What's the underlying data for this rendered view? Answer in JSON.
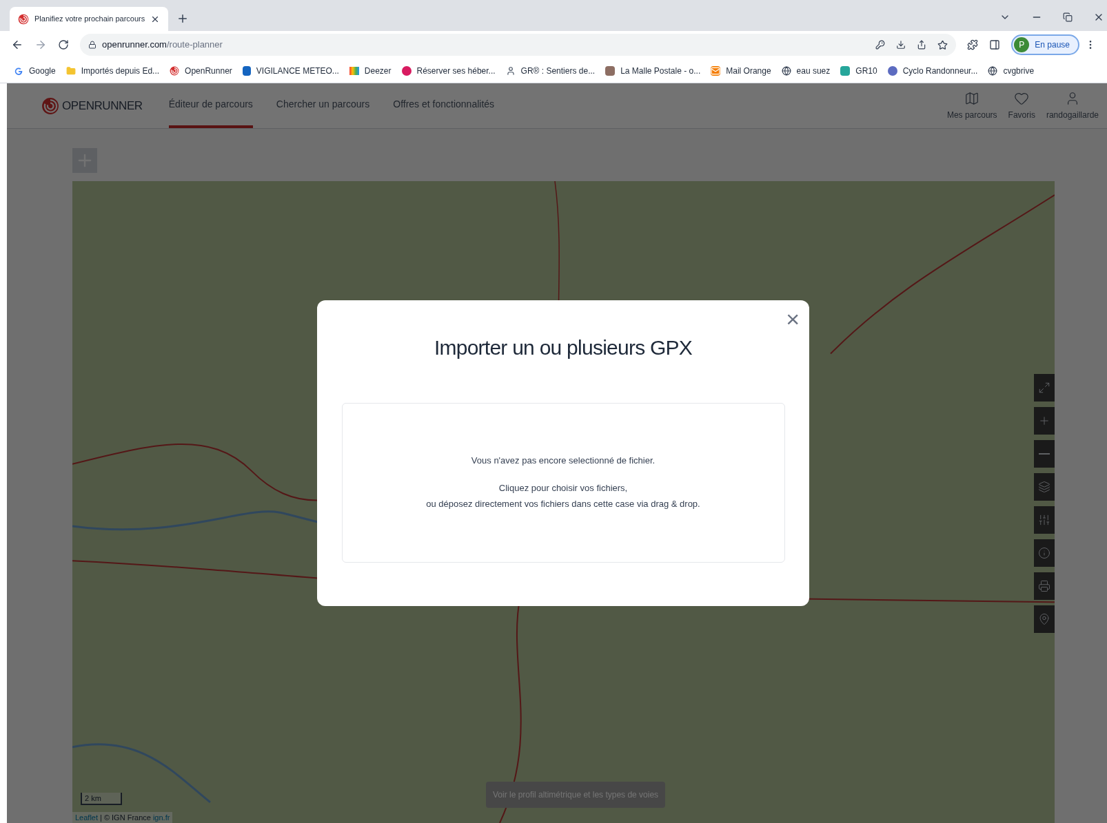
{
  "browser": {
    "tabs": [
      {
        "title": "Planifiez votre prochain parcours",
        "selected": true
      }
    ],
    "url": {
      "domain": "openrunner.com",
      "path": "/route-planner"
    },
    "profile": {
      "initial": "P",
      "label": "En pause"
    },
    "bookmarks": [
      "Google",
      "Importés depuis Ed...",
      "OpenRunner",
      "VIGILANCE METEO...",
      "Deezer",
      "Réserver ses héber...",
      "GR® : Sentiers de...",
      "La Malle Postale - o...",
      "Mail Orange",
      "eau suez",
      "GR10",
      "Cyclo Randonneur...",
      "cvgbrive"
    ]
  },
  "app": {
    "logo": "OPENRUNNER",
    "nav": [
      {
        "label": "Éditeur de parcours",
        "selected": true
      },
      {
        "label": "Chercher un parcours",
        "selected": false
      },
      {
        "label": "Offres et fonctionnalités",
        "selected": false
      }
    ],
    "user_nav": [
      {
        "label": "Mes parcours"
      },
      {
        "label": "Favoris"
      },
      {
        "label": "randogaillarde"
      }
    ]
  },
  "map": {
    "scale": "2 km",
    "attribution": {
      "leaflet": "Leaflet",
      "separator": "|",
      "credit": "© IGN France",
      "link": "ign.fr"
    },
    "profile_button": "Voir le profil altimétrique et les types de voies"
  },
  "modal": {
    "title": "Importer un ou plusieurs GPX",
    "close": "×",
    "message": "Vous n'avez pas encore selectionné de fichier.",
    "instructions": [
      "Cliquez pour choisir vos fichiers,",
      "ou déposez directement vos fichiers dans cette case via drag & drop."
    ]
  }
}
